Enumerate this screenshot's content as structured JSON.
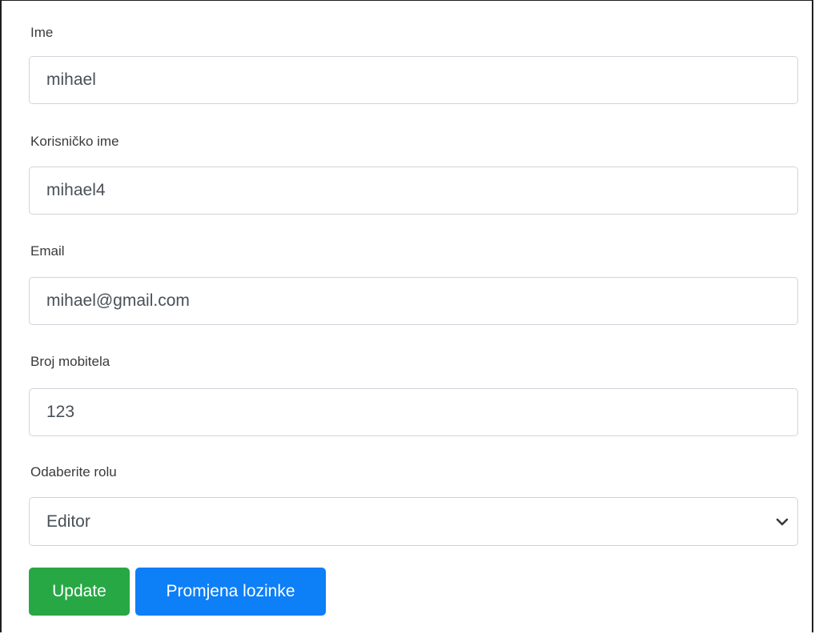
{
  "form": {
    "fields": [
      {
        "label": "Ime",
        "value": "mihael"
      },
      {
        "label": "Korisničko ime",
        "value": "mihael4"
      },
      {
        "label": "Email",
        "value": "mihael@gmail.com"
      },
      {
        "label": "Broj mobitela",
        "value": "123"
      }
    ],
    "role": {
      "label": "Odaberite rolu",
      "selected": "Editor"
    },
    "buttons": {
      "update": "Update",
      "change_password": "Promjena lozinke"
    }
  },
  "colors": {
    "update_button": "#28a745",
    "password_button": "#0d7ff7",
    "input_border": "#cfd4da",
    "text": "#495057"
  },
  "icons": {
    "select_arrow": "chevron-down-icon"
  }
}
